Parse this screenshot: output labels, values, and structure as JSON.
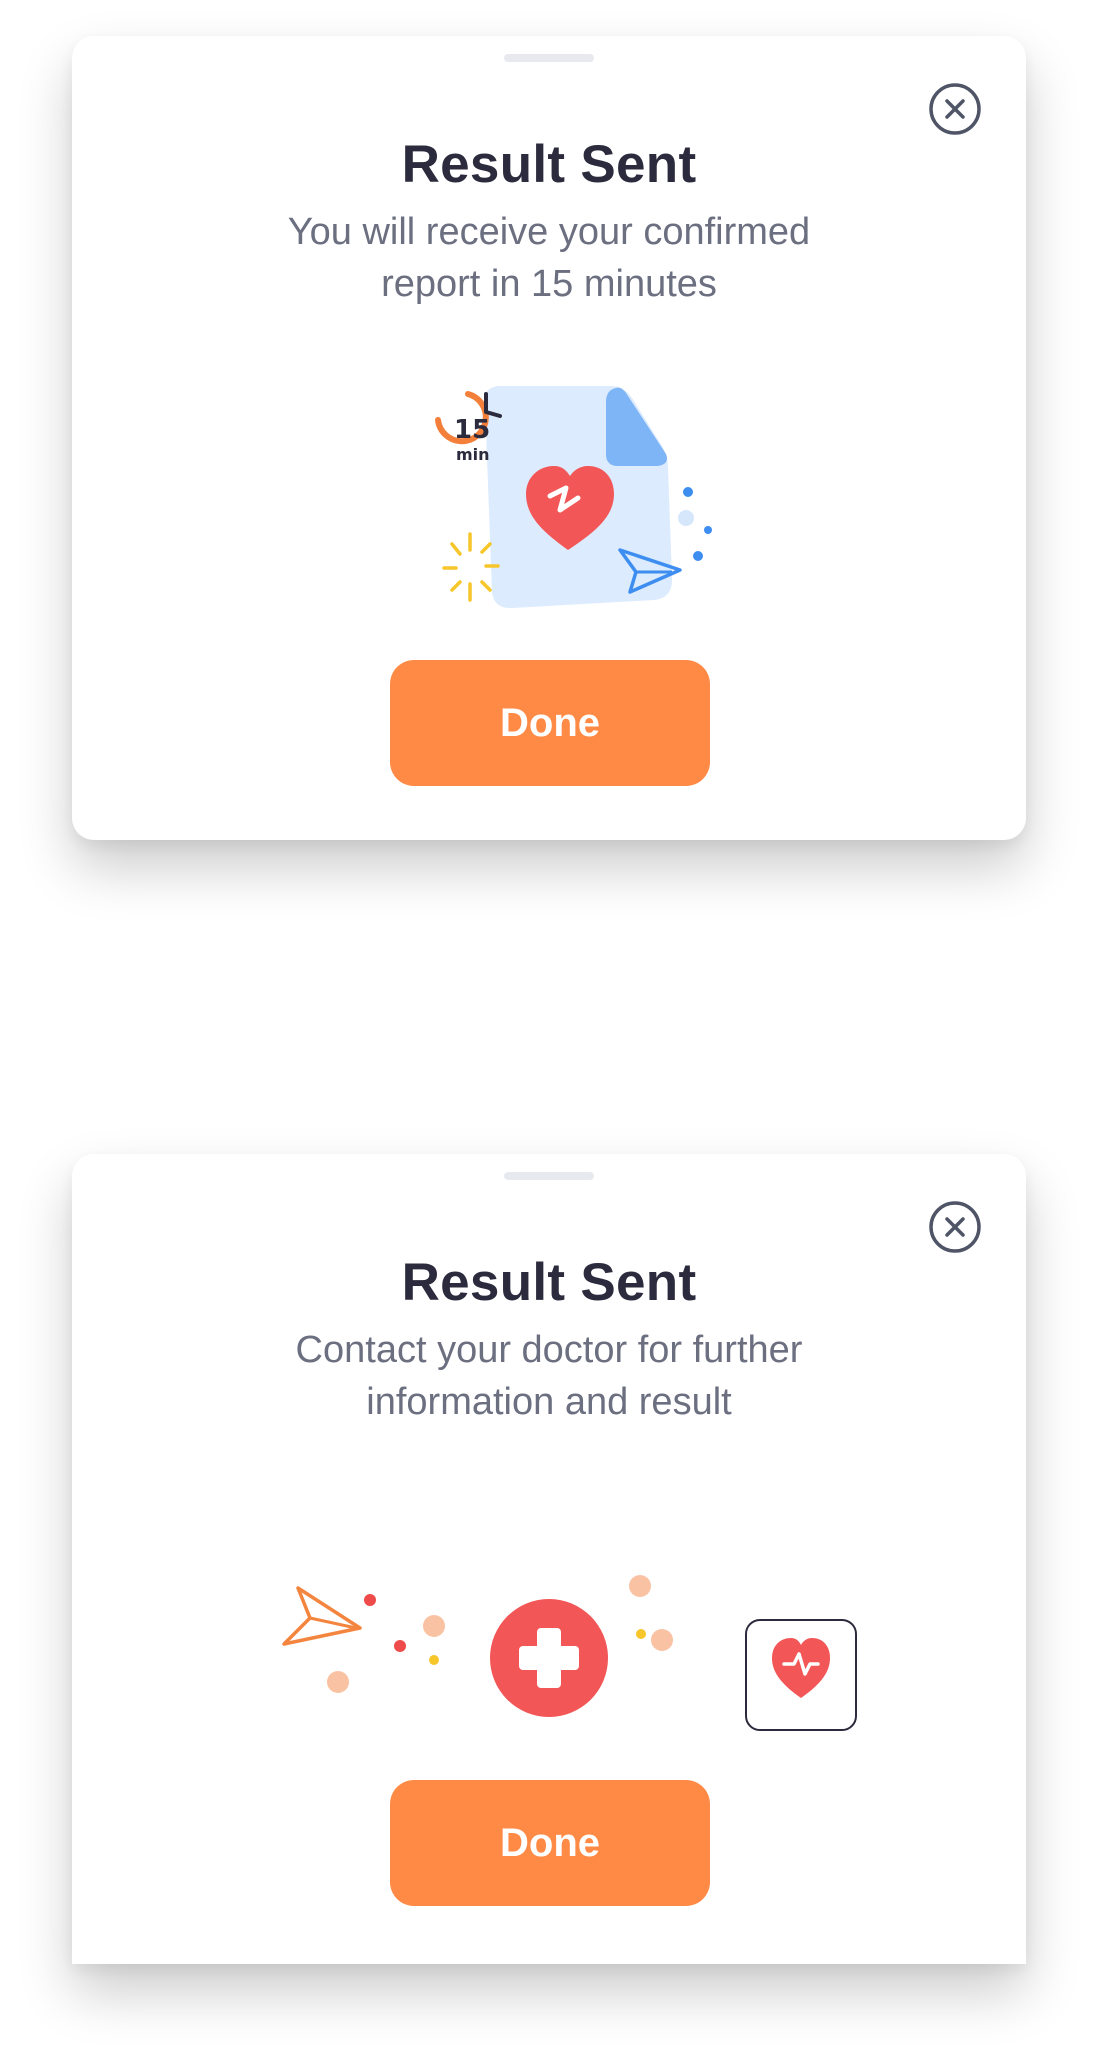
{
  "sheets": [
    {
      "title": "Result Sent",
      "message": "You will receive your confirmed report in 15 minutes",
      "illustration": {
        "icons": [
          "clock-icon",
          "document-icon",
          "heart-pulse-icon",
          "send-icon",
          "sparkle-icon"
        ],
        "timer_number": "15",
        "timer_unit": "min"
      },
      "done_label": "Done",
      "close_icon": "close-icon"
    },
    {
      "title": "Result Sent",
      "message": "Contact your doctor for further information and result",
      "illustration": {
        "icons": [
          "send-icon",
          "medical-cross-icon",
          "heart-pulse-icon",
          "confetti-dots"
        ]
      },
      "done_label": "Done",
      "close_icon": "close-icon"
    }
  ],
  "colors": {
    "accent": "#ff8a45",
    "title": "#2b2b3d",
    "text": "#6b6f80",
    "heart": "#f25656",
    "document": "#dcebfd",
    "document_fold": "#7eb5f7",
    "send_blue": "#3d8ef0",
    "clock_orange": "#f47f3a",
    "sparkle": "#f6c62a",
    "dot_peach": "#f9c2a2",
    "dot_red": "#ef4b4b"
  }
}
